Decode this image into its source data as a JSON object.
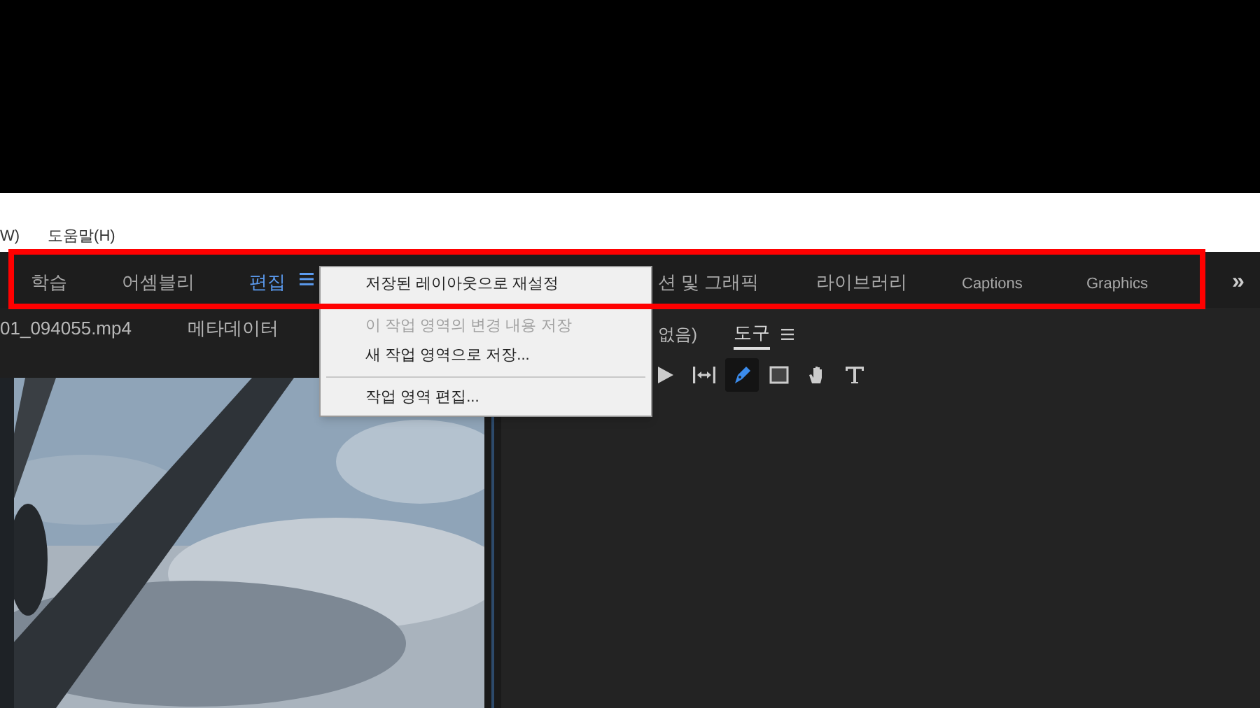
{
  "menu_bar": {
    "items": [
      "W)",
      "도움말(H)"
    ]
  },
  "workspace_bar": {
    "tabs": [
      {
        "label": "학습",
        "selected": false
      },
      {
        "label": "어셈블리",
        "selected": false
      },
      {
        "label": "편집",
        "selected": true
      },
      {
        "label": "션 및 그래픽",
        "selected": false
      },
      {
        "label": "라이브러리",
        "selected": false
      },
      {
        "label": "Captions",
        "selected": false
      },
      {
        "label": "Graphics",
        "selected": false
      }
    ],
    "overflow": "»"
  },
  "workspace_menu": {
    "items": [
      {
        "kind": "item",
        "label": "저장된 레이아웃으로 재설정",
        "disabled": false
      },
      {
        "kind": "item",
        "label": "이 작업 영역의 변경 내용 저장",
        "disabled": true
      },
      {
        "kind": "item",
        "label": "새 작업 영역으로 저장...",
        "disabled": false
      },
      {
        "kind": "separator"
      },
      {
        "kind": "item",
        "label": "작업 영역 편집...",
        "disabled": false
      }
    ]
  },
  "source_panel": {
    "tabs": [
      "01_094055.mp4",
      "메타데이터"
    ]
  },
  "tools_panel": {
    "caption": "없음)",
    "tab": "도구",
    "tools": [
      {
        "kind": "arrow",
        "selected": false
      },
      {
        "kind": "track",
        "selected": false
      },
      {
        "kind": "pen",
        "selected": true
      },
      {
        "kind": "rect",
        "selected": false
      },
      {
        "kind": "hand",
        "selected": false
      },
      {
        "kind": "type",
        "selected": false
      }
    ]
  }
}
